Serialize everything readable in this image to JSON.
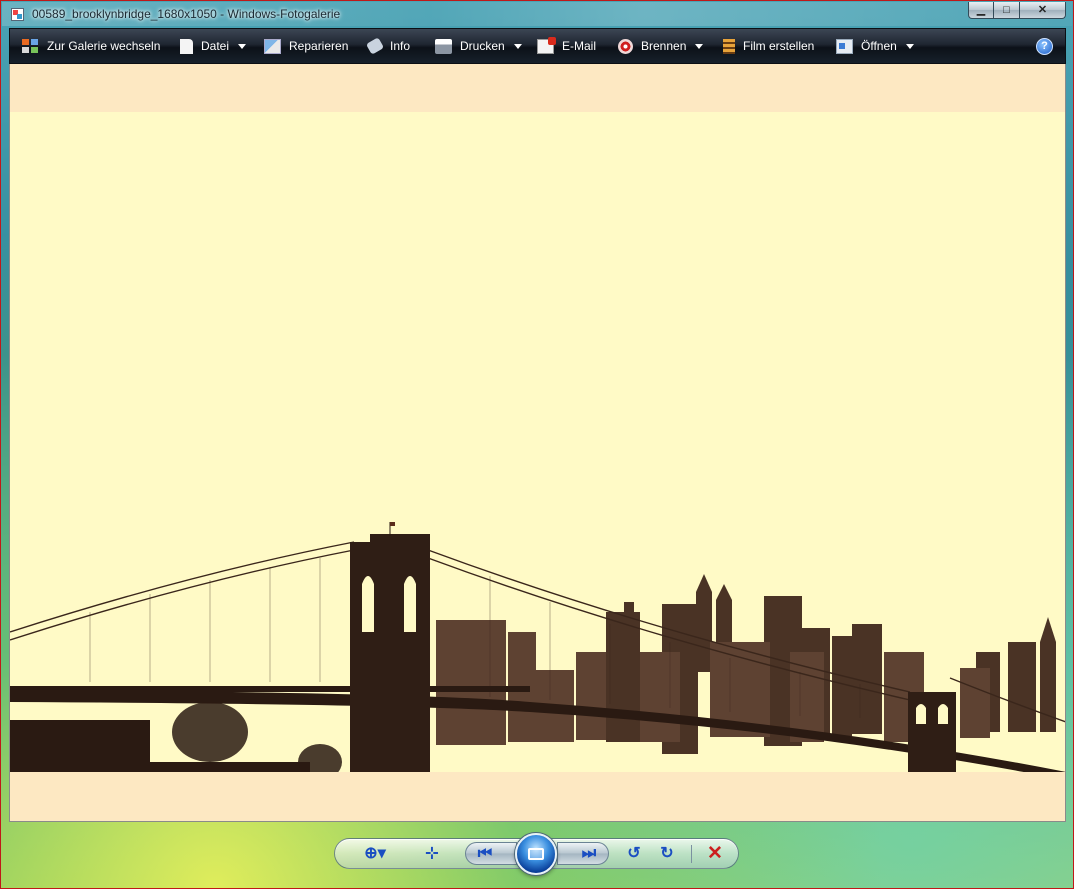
{
  "window": {
    "title": "00589_brooklynbridge_1680x1050 - Windows-Fotogalerie",
    "app_icon": "photo-gallery-icon",
    "caption": {
      "minimize_glyph": "▁",
      "maximize_glyph": "□",
      "close_glyph": "✕"
    }
  },
  "toolbar": {
    "items": [
      {
        "label": "Zur Galerie wechseln",
        "icon": "gallery-icon",
        "dropdown": false
      },
      {
        "label": "Datei",
        "icon": "file-icon",
        "dropdown": true
      },
      {
        "label": "Reparieren",
        "icon": "repair-icon",
        "dropdown": false
      },
      {
        "label": "Info",
        "icon": "info-tag-icon",
        "dropdown": false
      },
      {
        "label": "Drucken",
        "icon": "printer-icon",
        "dropdown": true
      },
      {
        "label": "E-Mail",
        "icon": "email-icon",
        "dropdown": false
      },
      {
        "label": "Brennen",
        "icon": "burn-disc-icon",
        "dropdown": true
      },
      {
        "label": "Film erstellen",
        "icon": "film-icon",
        "dropdown": false
      },
      {
        "label": "Öffnen",
        "icon": "open-icon",
        "dropdown": true
      }
    ],
    "help_glyph": "?"
  },
  "photo": {
    "subject": "Brooklyn Bridge and Manhattan skyline, sepia tone",
    "background_color": "#fffac6",
    "letterbox_color": "#fde8c2",
    "ink_color": "#2a1a12"
  },
  "navigation": {
    "zoom_glyph": "⊕▾",
    "fit_glyph": "⊹",
    "previous_glyph": "⏮",
    "slideshow_icon": "slideshow-icon",
    "next_glyph": "⏭",
    "rotate_left_glyph": "↺",
    "rotate_right_glyph": "↻",
    "delete_glyph": "✕"
  }
}
